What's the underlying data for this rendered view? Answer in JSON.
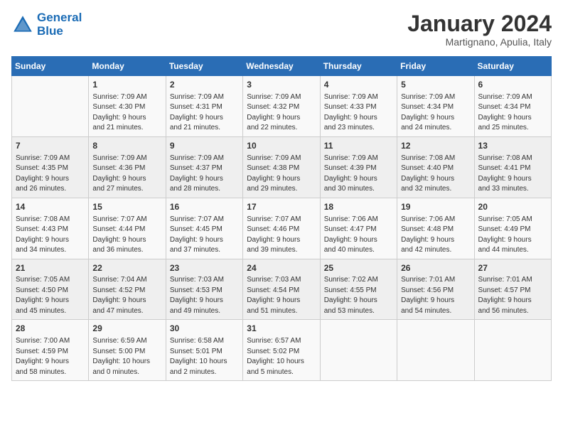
{
  "header": {
    "logo_line1": "General",
    "logo_line2": "Blue",
    "month_title": "January 2024",
    "location": "Martignano, Apulia, Italy"
  },
  "weekdays": [
    "Sunday",
    "Monday",
    "Tuesday",
    "Wednesday",
    "Thursday",
    "Friday",
    "Saturday"
  ],
  "weeks": [
    [
      {
        "day": "",
        "info": ""
      },
      {
        "day": "1",
        "info": "Sunrise: 7:09 AM\nSunset: 4:30 PM\nDaylight: 9 hours\nand 21 minutes."
      },
      {
        "day": "2",
        "info": "Sunrise: 7:09 AM\nSunset: 4:31 PM\nDaylight: 9 hours\nand 21 minutes."
      },
      {
        "day": "3",
        "info": "Sunrise: 7:09 AM\nSunset: 4:32 PM\nDaylight: 9 hours\nand 22 minutes."
      },
      {
        "day": "4",
        "info": "Sunrise: 7:09 AM\nSunset: 4:33 PM\nDaylight: 9 hours\nand 23 minutes."
      },
      {
        "day": "5",
        "info": "Sunrise: 7:09 AM\nSunset: 4:34 PM\nDaylight: 9 hours\nand 24 minutes."
      },
      {
        "day": "6",
        "info": "Sunrise: 7:09 AM\nSunset: 4:34 PM\nDaylight: 9 hours\nand 25 minutes."
      }
    ],
    [
      {
        "day": "7",
        "info": "Sunrise: 7:09 AM\nSunset: 4:35 PM\nDaylight: 9 hours\nand 26 minutes."
      },
      {
        "day": "8",
        "info": "Sunrise: 7:09 AM\nSunset: 4:36 PM\nDaylight: 9 hours\nand 27 minutes."
      },
      {
        "day": "9",
        "info": "Sunrise: 7:09 AM\nSunset: 4:37 PM\nDaylight: 9 hours\nand 28 minutes."
      },
      {
        "day": "10",
        "info": "Sunrise: 7:09 AM\nSunset: 4:38 PM\nDaylight: 9 hours\nand 29 minutes."
      },
      {
        "day": "11",
        "info": "Sunrise: 7:09 AM\nSunset: 4:39 PM\nDaylight: 9 hours\nand 30 minutes."
      },
      {
        "day": "12",
        "info": "Sunrise: 7:08 AM\nSunset: 4:40 PM\nDaylight: 9 hours\nand 32 minutes."
      },
      {
        "day": "13",
        "info": "Sunrise: 7:08 AM\nSunset: 4:41 PM\nDaylight: 9 hours\nand 33 minutes."
      }
    ],
    [
      {
        "day": "14",
        "info": "Sunrise: 7:08 AM\nSunset: 4:43 PM\nDaylight: 9 hours\nand 34 minutes."
      },
      {
        "day": "15",
        "info": "Sunrise: 7:07 AM\nSunset: 4:44 PM\nDaylight: 9 hours\nand 36 minutes."
      },
      {
        "day": "16",
        "info": "Sunrise: 7:07 AM\nSunset: 4:45 PM\nDaylight: 9 hours\nand 37 minutes."
      },
      {
        "day": "17",
        "info": "Sunrise: 7:07 AM\nSunset: 4:46 PM\nDaylight: 9 hours\nand 39 minutes."
      },
      {
        "day": "18",
        "info": "Sunrise: 7:06 AM\nSunset: 4:47 PM\nDaylight: 9 hours\nand 40 minutes."
      },
      {
        "day": "19",
        "info": "Sunrise: 7:06 AM\nSunset: 4:48 PM\nDaylight: 9 hours\nand 42 minutes."
      },
      {
        "day": "20",
        "info": "Sunrise: 7:05 AM\nSunset: 4:49 PM\nDaylight: 9 hours\nand 44 minutes."
      }
    ],
    [
      {
        "day": "21",
        "info": "Sunrise: 7:05 AM\nSunset: 4:50 PM\nDaylight: 9 hours\nand 45 minutes."
      },
      {
        "day": "22",
        "info": "Sunrise: 7:04 AM\nSunset: 4:52 PM\nDaylight: 9 hours\nand 47 minutes."
      },
      {
        "day": "23",
        "info": "Sunrise: 7:03 AM\nSunset: 4:53 PM\nDaylight: 9 hours\nand 49 minutes."
      },
      {
        "day": "24",
        "info": "Sunrise: 7:03 AM\nSunset: 4:54 PM\nDaylight: 9 hours\nand 51 minutes."
      },
      {
        "day": "25",
        "info": "Sunrise: 7:02 AM\nSunset: 4:55 PM\nDaylight: 9 hours\nand 53 minutes."
      },
      {
        "day": "26",
        "info": "Sunrise: 7:01 AM\nSunset: 4:56 PM\nDaylight: 9 hours\nand 54 minutes."
      },
      {
        "day": "27",
        "info": "Sunrise: 7:01 AM\nSunset: 4:57 PM\nDaylight: 9 hours\nand 56 minutes."
      }
    ],
    [
      {
        "day": "28",
        "info": "Sunrise: 7:00 AM\nSunset: 4:59 PM\nDaylight: 9 hours\nand 58 minutes."
      },
      {
        "day": "29",
        "info": "Sunrise: 6:59 AM\nSunset: 5:00 PM\nDaylight: 10 hours\nand 0 minutes."
      },
      {
        "day": "30",
        "info": "Sunrise: 6:58 AM\nSunset: 5:01 PM\nDaylight: 10 hours\nand 2 minutes."
      },
      {
        "day": "31",
        "info": "Sunrise: 6:57 AM\nSunset: 5:02 PM\nDaylight: 10 hours\nand 5 minutes."
      },
      {
        "day": "",
        "info": ""
      },
      {
        "day": "",
        "info": ""
      },
      {
        "day": "",
        "info": ""
      }
    ]
  ]
}
